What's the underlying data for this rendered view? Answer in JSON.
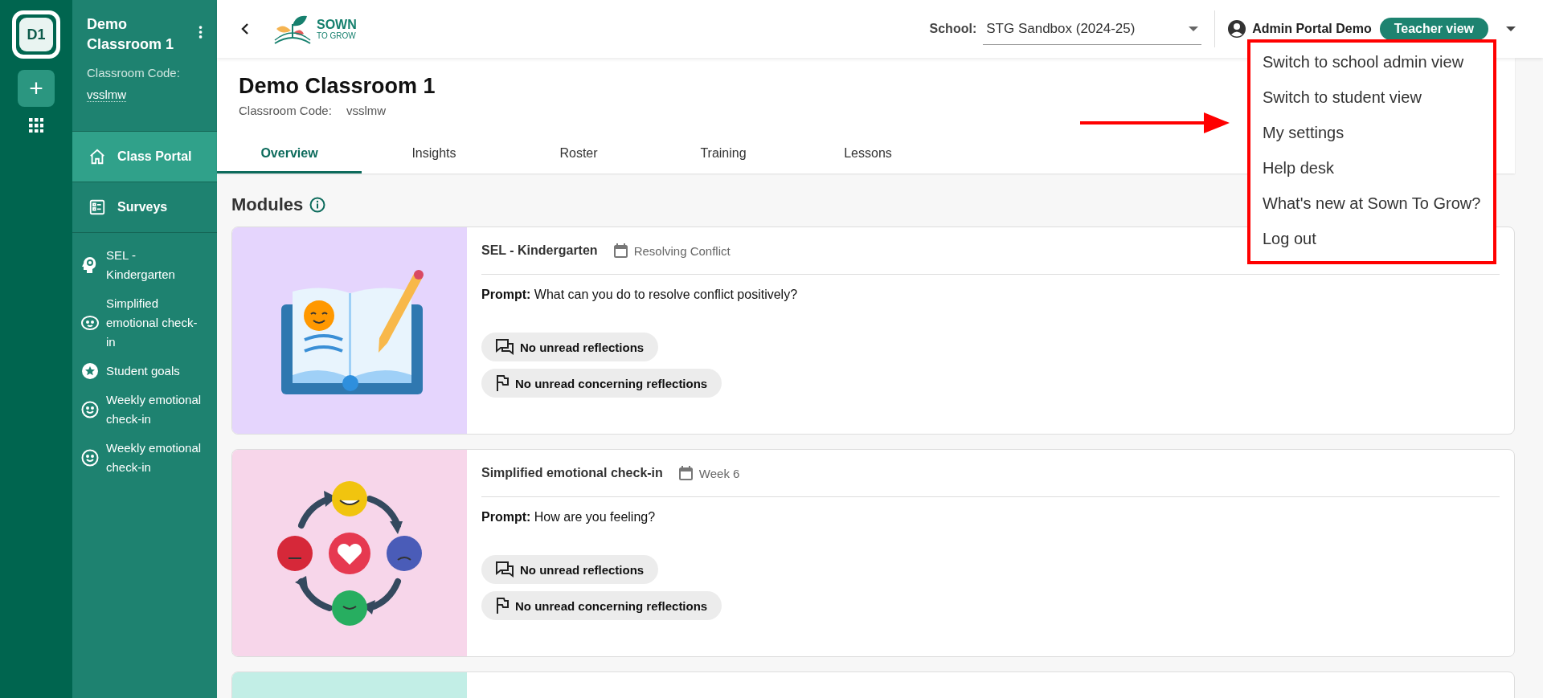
{
  "rail": {
    "badge": "D1",
    "add": "+"
  },
  "sidebar": {
    "title": "Demo Classroom 1",
    "code_label": "Classroom Code:",
    "code": "vsslmw",
    "nav": [
      {
        "label": "Class Portal",
        "selected": true
      },
      {
        "label": "Surveys",
        "selected": false
      }
    ],
    "modules": [
      "SEL - Kindergarten",
      "Simplified emotional check-in",
      "Student goals",
      "Weekly emotional check-in",
      "Weekly emotional check-in"
    ]
  },
  "header": {
    "logo_top": "SOWN",
    "logo_bottom": "TO GROW",
    "school_label": "School:",
    "school": "STG Sandbox (2024-25)",
    "user": "Admin Portal Demo",
    "view": "Teacher view"
  },
  "classroom": {
    "title": "Demo Classroom 1",
    "code_label": "Classroom Code:",
    "code": "vsslmw"
  },
  "tabs": [
    {
      "label": "Overview",
      "selected": true
    },
    {
      "label": "Insights",
      "selected": false
    },
    {
      "label": "Roster",
      "selected": false
    },
    {
      "label": "Training",
      "selected": false
    },
    {
      "label": "Lessons",
      "selected": false
    }
  ],
  "modules_heading": "Modules",
  "cards": [
    {
      "kind": "book",
      "color": "#e5d5fd",
      "title": "SEL - Kindergarten",
      "meta": "Resolving Conflict",
      "prompt": "**Prompt:** What can you do to resolve conflict positively?",
      "chips": [
        "No unread reflections",
        "No unread concerning reflections"
      ]
    },
    {
      "kind": "emotions",
      "color": "#f7d6ea",
      "title": "Simplified emotional check-in",
      "meta": "Week 6",
      "prompt": "**Prompt:** How are you feeling?",
      "chips": [
        "No unread reflections",
        "No unread concerning reflections"
      ]
    },
    {
      "kind": "blank",
      "color": "#c2eee6"
    }
  ],
  "menu": {
    "items": [
      "Switch to school admin view",
      "Switch to student view",
      "My settings",
      "Help desk",
      "What's new at Sown To Grow?",
      "Log out"
    ]
  }
}
